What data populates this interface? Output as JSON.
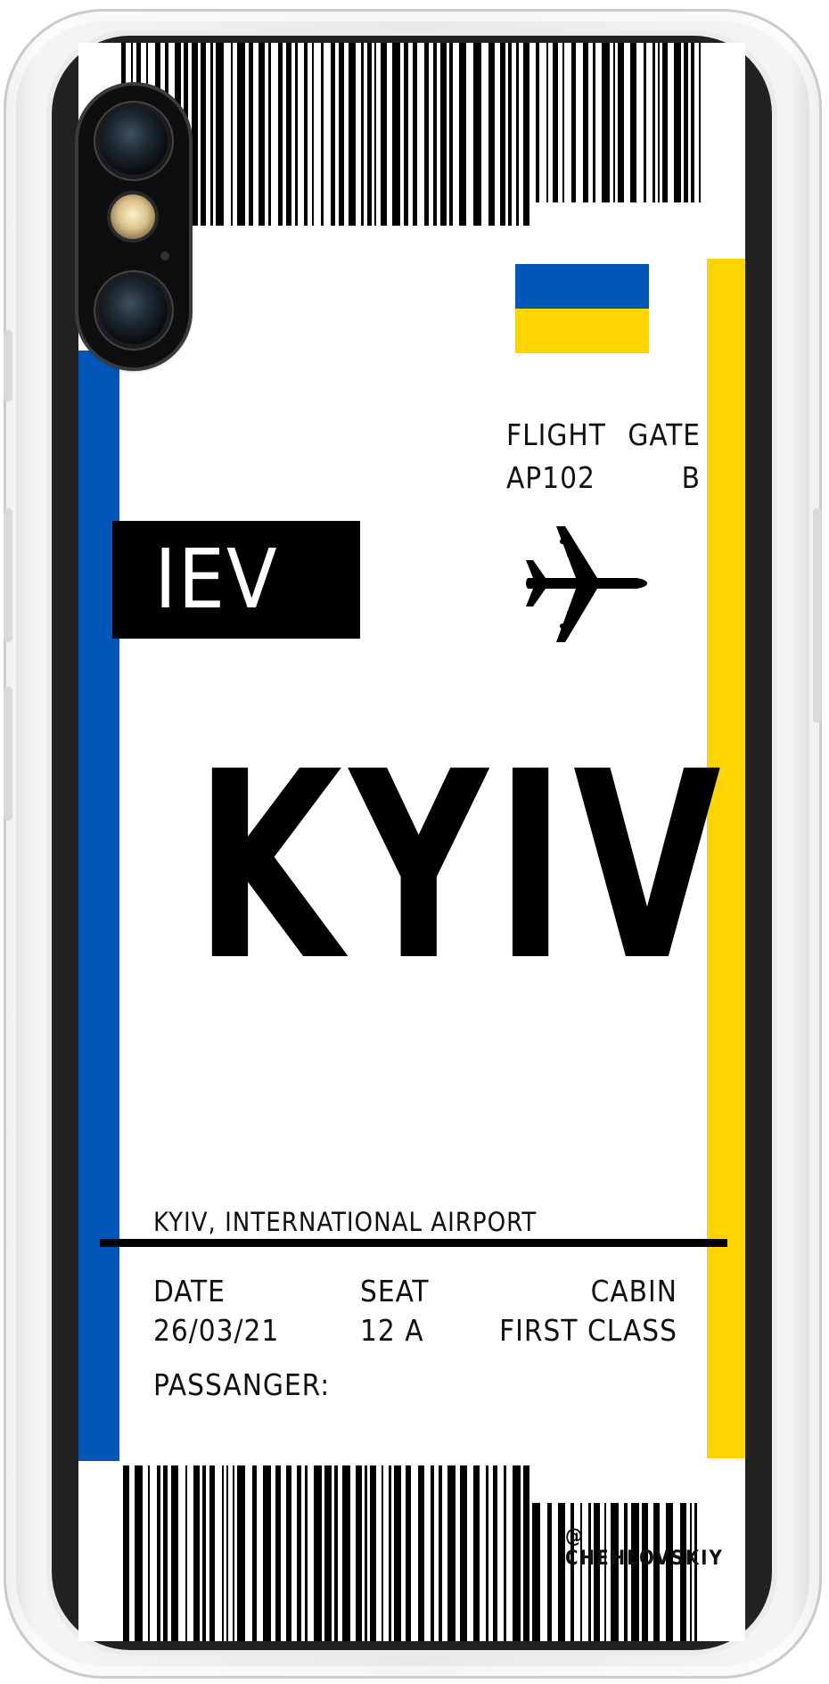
{
  "brand": {
    "ukraine_blue": "#0057B8",
    "ukraine_yellow": "#FFD500"
  },
  "ticket": {
    "flight": {
      "label": "FLIGHT",
      "value": "AP102"
    },
    "gate": {
      "label": "GATE",
      "value": "B"
    },
    "airport_code": "IEV",
    "city": "KYIV",
    "airport_name": "KYIV, INTERNATIONAL AIRPORT",
    "date": {
      "label": "DATE",
      "value": "26/03/21"
    },
    "seat": {
      "label": "SEAT",
      "value": "12 A"
    },
    "cabin": {
      "label": "CABIN",
      "value": "FIRST CLASS"
    },
    "passenger_label": "PASSANGER:",
    "watermark": "@ CHEHLOVSKIY"
  },
  "icons": [
    "airplane-icon",
    "ukraine-flag"
  ]
}
